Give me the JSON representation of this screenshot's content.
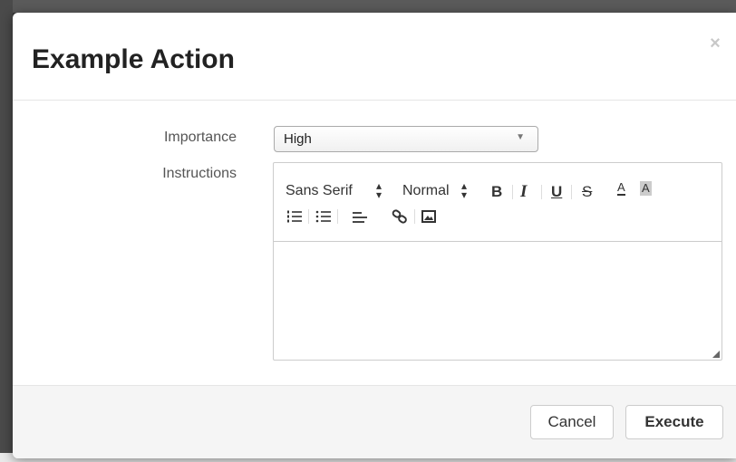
{
  "modal": {
    "title": "Example Action",
    "close_symbol": "×"
  },
  "form": {
    "importance": {
      "label": "Importance",
      "selected": "High"
    },
    "instructions": {
      "label": "Instructions",
      "toolbar": {
        "font_family": "Sans Serif",
        "font_size": "Normal",
        "bold": "B",
        "italic": "I",
        "underline": "U",
        "strike": "S",
        "color": "A",
        "background": "A"
      },
      "content": ""
    }
  },
  "footer": {
    "cancel_label": "Cancel",
    "execute_label": "Execute"
  },
  "icons": [
    "close-icon",
    "chevron-down-icon",
    "ordered-list-icon",
    "bullet-list-icon",
    "align-icon",
    "link-icon",
    "image-icon",
    "resize-grip-icon"
  ]
}
